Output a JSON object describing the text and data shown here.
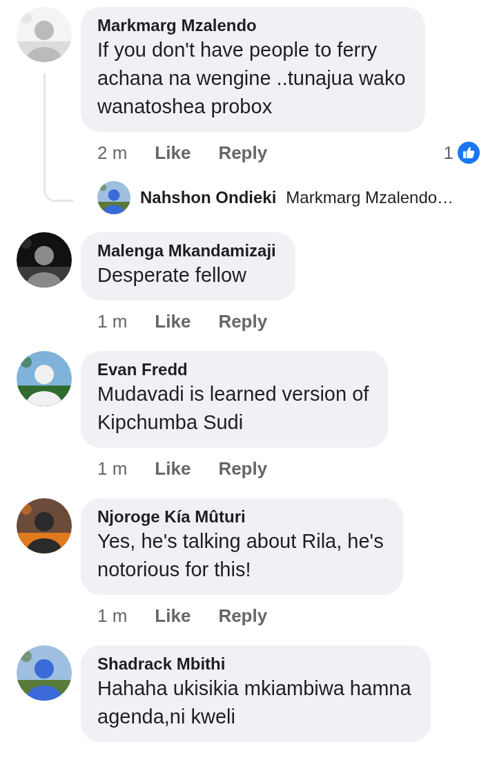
{
  "comments": [
    {
      "author": "Markmarg Mzalendo",
      "text": "If you don't have people to ferry\nachana na wengine ..tunajua wako\nwanatoshea probox",
      "time": "2 m",
      "actions": [
        "Like",
        "Reply"
      ],
      "reactions": {
        "count": "1"
      },
      "reply_preview": {
        "author": "Nahshon Ondieki",
        "text": "Markmarg Mzalendo…"
      }
    },
    {
      "author": "Malenga Mkandamizaji",
      "text": "Desperate fellow",
      "time": "1 m",
      "actions": [
        "Like",
        "Reply"
      ]
    },
    {
      "author": "Evan Fredd",
      "text": "Mudavadi is learned version of\nKipchumba Sudi",
      "time": "1 m",
      "actions": [
        "Like",
        "Reply"
      ]
    },
    {
      "author": "Njoroge Kía Mûturi",
      "text": "Yes, he's talking about Rila, he's\nnotorious for this!",
      "time": "1 m",
      "actions": [
        "Like",
        "Reply"
      ]
    },
    {
      "author": "Shadrack Mbithi",
      "text": "Hahaha ukisikia mkiambiwa hamna\nagenda,ni kweli"
    }
  ]
}
